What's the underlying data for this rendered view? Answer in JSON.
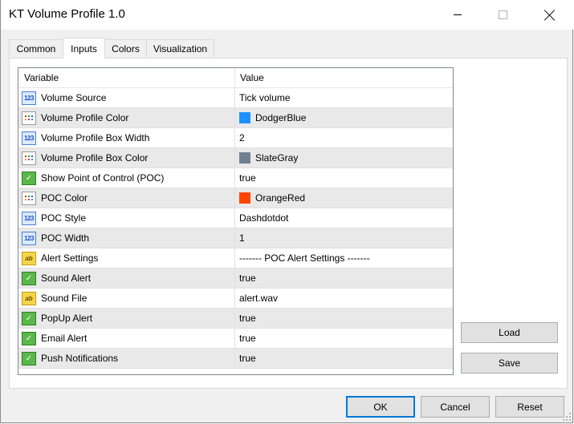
{
  "window": {
    "title": "KT Volume Profile 1.0"
  },
  "tabs": [
    {
      "label": "Common",
      "active": false
    },
    {
      "label": "Inputs",
      "active": true
    },
    {
      "label": "Colors",
      "active": false
    },
    {
      "label": "Visualization",
      "active": false
    }
  ],
  "grid": {
    "headers": {
      "variable": "Variable",
      "value": "Value"
    },
    "rows": [
      {
        "icon": "number-icon",
        "variable": "Volume Source",
        "value": "Tick volume"
      },
      {
        "icon": "color-icon",
        "variable": "Volume Profile Color",
        "value": "DodgerBlue",
        "swatch": "#1e90ff"
      },
      {
        "icon": "number-icon",
        "variable": "Volume Profile Box Width",
        "value": "2"
      },
      {
        "icon": "color-icon",
        "variable": "Volume Profile Box Color",
        "value": "SlateGray",
        "swatch": "#708090"
      },
      {
        "icon": "boolean-icon",
        "variable": "Show Point of Control (POC)",
        "value": "true"
      },
      {
        "icon": "color-icon",
        "variable": "POC Color",
        "value": "OrangeRed",
        "swatch": "#ff4500"
      },
      {
        "icon": "number-icon",
        "variable": "POC Style",
        "value": "Dashdotdot"
      },
      {
        "icon": "number-icon",
        "variable": "POC Width",
        "value": "1"
      },
      {
        "icon": "string-icon",
        "variable": "Alert Settings",
        "value": "------- POC Alert Settings -------"
      },
      {
        "icon": "boolean-icon",
        "variable": "Sound Alert",
        "value": "true"
      },
      {
        "icon": "string-icon",
        "variable": "Sound File",
        "value": "alert.wav"
      },
      {
        "icon": "boolean-icon",
        "variable": "PopUp Alert",
        "value": "true"
      },
      {
        "icon": "boolean-icon",
        "variable": "Email Alert",
        "value": "true"
      },
      {
        "icon": "boolean-icon",
        "variable": "Push Notifications",
        "value": "true"
      }
    ]
  },
  "side_buttons": {
    "load": "Load",
    "save": "Save"
  },
  "footer_buttons": {
    "ok": "OK",
    "cancel": "Cancel",
    "reset": "Reset"
  },
  "icon_glyphs": {
    "number": "123",
    "string": "ab",
    "boolean": "✓"
  }
}
